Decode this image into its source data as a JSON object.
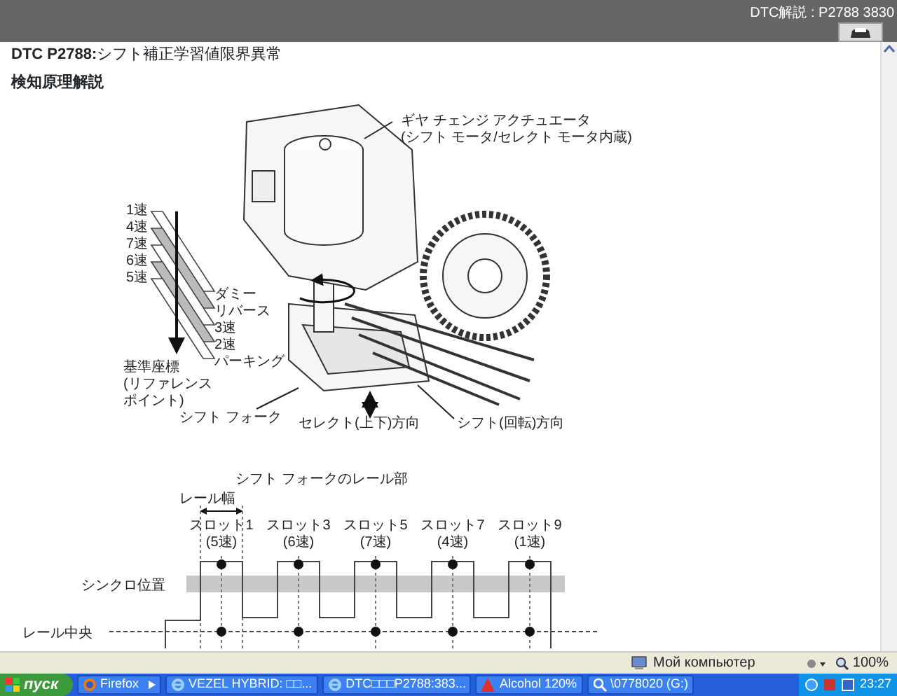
{
  "header": {
    "breadcrumb": "DTC解説 : P2788 3830"
  },
  "document": {
    "title": "**DTC P2788:**シフト補正学習値限界異常",
    "section": "検知原理解説",
    "figure_1": {
      "actuator_label": [
        "ギヤ チェンジ アクチュエータ",
        "(シフト モータ/セレクト モータ内蔵)"
      ],
      "gear_labels": [
        "1速",
        "4速",
        "7速",
        "6速",
        "5速"
      ],
      "position_labels": [
        "ダミー",
        "リバース",
        "3速",
        "2速",
        "パーキング"
      ],
      "reference_label": [
        "基準座標",
        "(リファレンス",
        "ポイント)"
      ],
      "fork_label": "シフト フォーク",
      "shift_label": "シフト(回転)方向",
      "select_label": "セレクト(上下)方向"
    },
    "figure_2": {
      "title": "シフト フォークのレール部",
      "width_label": "レール幅",
      "slots": [
        {
          "name": "スロット1",
          "gear": "(5速)"
        },
        {
          "name": "スロット3",
          "gear": "(6速)"
        },
        {
          "name": "スロット5",
          "gear": "(7速)"
        },
        {
          "name": "スロット7",
          "gear": "(4速)"
        },
        {
          "name": "スロット9",
          "gear": "(1速)"
        }
      ],
      "synchro_label": "シンクロ位置",
      "center_label": "レール中央"
    }
  },
  "status_bar": {
    "zone": "Мой компьютер",
    "zoom": "100%"
  },
  "taskbar": {
    "start": "пуск",
    "tasks": [
      {
        "label": "Firefox",
        "kind": "firefox"
      },
      {
        "label": "VEZEL HYBRID: □□...",
        "kind": "ie"
      },
      {
        "label": "DTC□□□P2788:383...",
        "kind": "ie"
      },
      {
        "label": "Alcohol 120%",
        "kind": "alcohol"
      },
      {
        "label": "\\0778020 (G:)",
        "kind": "drive"
      }
    ],
    "clock": "23:27"
  }
}
